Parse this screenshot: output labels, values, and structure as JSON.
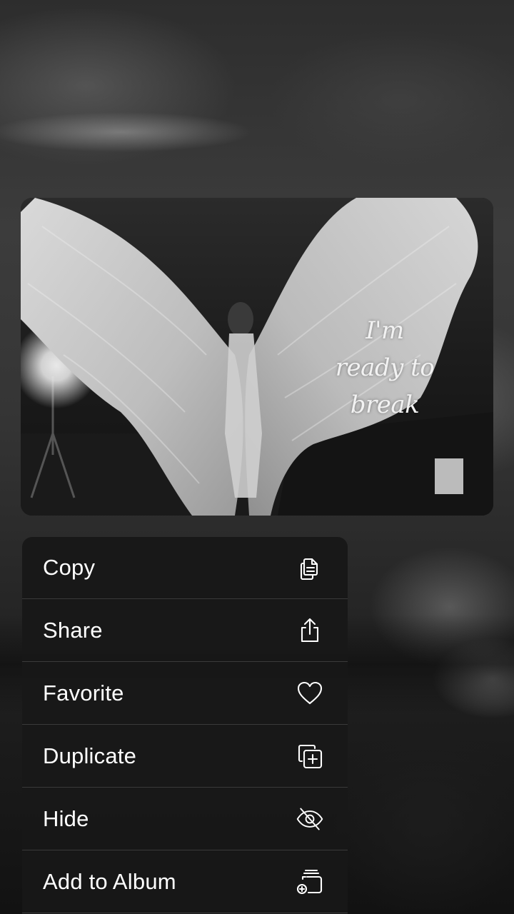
{
  "preview": {
    "caption_lines": [
      "I'm",
      "ready to",
      "break"
    ],
    "caption_raw": "I’m ready to break"
  },
  "menu": {
    "items": [
      {
        "label": "Copy",
        "icon": "copy-icon"
      },
      {
        "label": "Share",
        "icon": "share-icon"
      },
      {
        "label": "Favorite",
        "icon": "heart-icon"
      },
      {
        "label": "Duplicate",
        "icon": "duplicate-icon"
      },
      {
        "label": "Hide",
        "icon": "eye-slash-icon"
      },
      {
        "label": "Add to Album",
        "icon": "add-to-album-icon"
      }
    ]
  },
  "colors": {
    "menu_background": "#181818",
    "menu_separator": "#3a3a3a",
    "menu_text": "#ffffff"
  }
}
